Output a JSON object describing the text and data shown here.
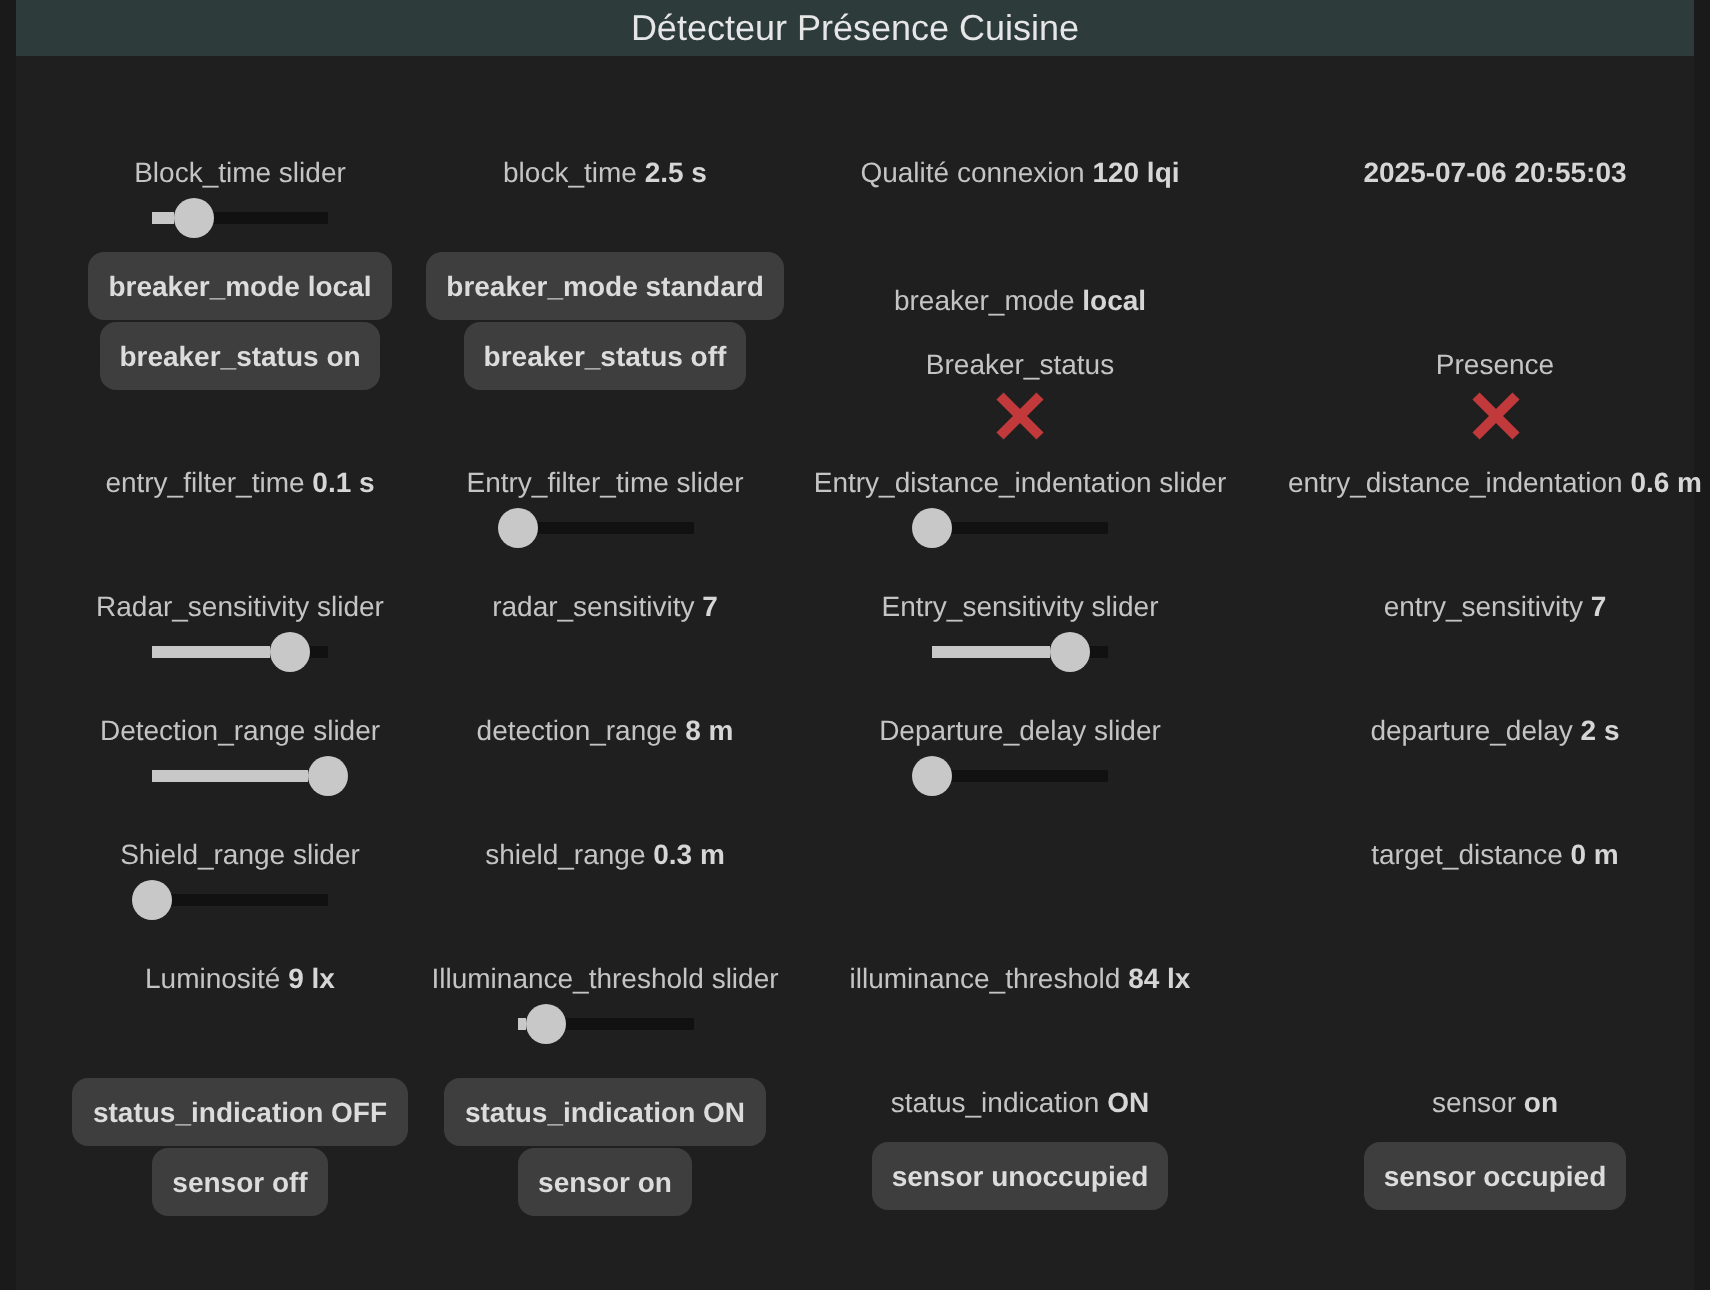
{
  "window": {
    "title": "Détecteur Présence Cuisine"
  },
  "rows": [
    {
      "cells": [
        {
          "items": [
            {
              "kind": "slider",
              "label": "Block_time slider",
              "level": 0.24
            }
          ]
        },
        {
          "items": [
            {
              "kind": "reading",
              "label": "block_time",
              "value": "2.5 s"
            }
          ]
        },
        {
          "items": [
            {
              "kind": "reading",
              "label": "Qualité connexion",
              "value": "120 lqi"
            }
          ]
        },
        {
          "items": [
            {
              "kind": "reading",
              "value": "2025-07-06 20:55:03"
            }
          ]
        }
      ]
    },
    {
      "cells": [
        {
          "items": [
            {
              "kind": "button",
              "text": "breaker_mode local"
            },
            {
              "kind": "button",
              "text": "breaker_status on"
            }
          ]
        },
        {
          "items": [
            {
              "kind": "button",
              "text": "breaker_mode standard"
            },
            {
              "kind": "button",
              "text": "breaker_status off"
            }
          ]
        },
        {
          "items": [
            {
              "kind": "reading",
              "label": "breaker_mode",
              "value": "local"
            },
            {
              "kind": "status",
              "label": "Breaker_status",
              "on": false
            }
          ]
        },
        {
          "items": [
            {
              "kind": "status",
              "label": "Presence",
              "on": false
            }
          ]
        }
      ]
    },
    {
      "cells": [
        {
          "items": [
            {
              "kind": "reading",
              "label": "entry_filter_time",
              "value": "0.1 s"
            }
          ]
        },
        {
          "items": [
            {
              "kind": "slider",
              "label": "Entry_filter_time slider",
              "level": 0
            }
          ]
        },
        {
          "items": [
            {
              "kind": "slider",
              "label": "Entry_distance_indentation slider",
              "level": 0
            }
          ]
        },
        {
          "items": [
            {
              "kind": "reading",
              "label": "entry_distance_indentation",
              "value": "0.6 m"
            }
          ]
        }
      ]
    },
    {
      "cells": [
        {
          "items": [
            {
              "kind": "slider",
              "label": "Radar_sensitivity slider",
              "level": 0.78
            }
          ]
        },
        {
          "items": [
            {
              "kind": "reading",
              "label": "radar_sensitivity",
              "value": "7"
            }
          ]
        },
        {
          "items": [
            {
              "kind": "slider",
              "label": "Entry_sensitivity slider",
              "level": 0.78
            }
          ]
        },
        {
          "items": [
            {
              "kind": "reading",
              "label": "entry_sensitivity",
              "value": "7"
            }
          ]
        }
      ]
    },
    {
      "cells": [
        {
          "items": [
            {
              "kind": "slider",
              "label": "Detection_range slider",
              "level": 1
            }
          ]
        },
        {
          "items": [
            {
              "kind": "reading",
              "label": "detection_range",
              "value": "8 m"
            }
          ]
        },
        {
          "items": [
            {
              "kind": "slider",
              "label": "Departure_delay slider",
              "level": 0
            }
          ]
        },
        {
          "items": [
            {
              "kind": "reading",
              "label": "departure_delay",
              "value": "2 s"
            }
          ]
        }
      ]
    },
    {
      "cells": [
        {
          "items": [
            {
              "kind": "slider",
              "label": "Shield_range slider",
              "level": 0
            }
          ]
        },
        {
          "items": [
            {
              "kind": "reading",
              "label": "shield_range",
              "value": "0.3 m"
            }
          ]
        },
        null,
        {
          "items": [
            {
              "kind": "reading",
              "label": "target_distance",
              "value": "0 m"
            }
          ]
        }
      ]
    },
    {
      "cells": [
        {
          "items": [
            {
              "kind": "reading",
              "label": "Luminosité",
              "value": "9 lx"
            }
          ]
        },
        {
          "items": [
            {
              "kind": "slider",
              "label": "Illuminance_threshold slider",
              "level": 0.17
            }
          ]
        },
        {
          "items": [
            {
              "kind": "reading",
              "label": "illuminance_threshold",
              "value": "84 lx"
            }
          ]
        },
        null
      ]
    },
    {
      "cells": [
        {
          "items": [
            {
              "kind": "button",
              "text": "status_indication OFF"
            },
            {
              "kind": "button",
              "text": "sensor off"
            }
          ]
        },
        {
          "items": [
            {
              "kind": "button",
              "text": "status_indication ON"
            },
            {
              "kind": "button",
              "text": "sensor on"
            }
          ]
        },
        {
          "items": [
            {
              "kind": "reading",
              "label": "status_indication",
              "value": "ON"
            },
            {
              "kind": "button",
              "text": "sensor unoccupied"
            }
          ]
        },
        {
          "items": [
            {
              "kind": "reading",
              "label": "sensor",
              "value": "on"
            },
            {
              "kind": "button",
              "text": "sensor occupied"
            }
          ]
        }
      ]
    }
  ]
}
